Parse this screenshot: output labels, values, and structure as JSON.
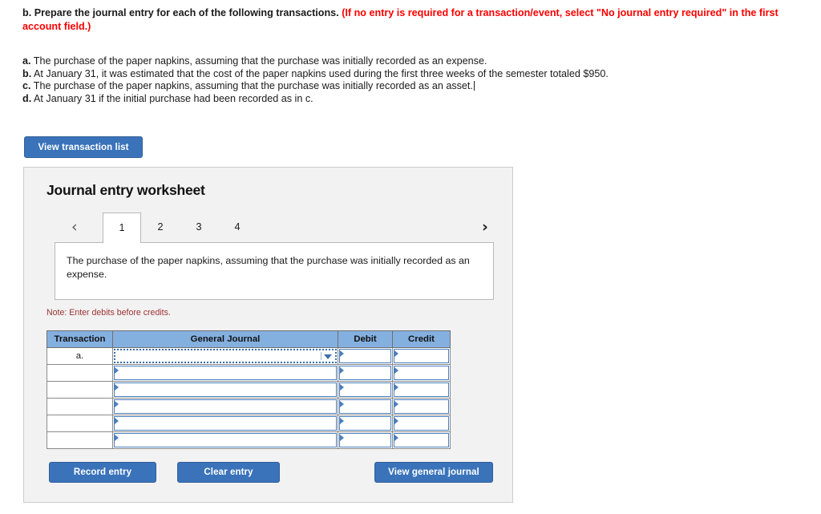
{
  "question": {
    "lead_label": "b.",
    "lead_text": " Prepare the journal entry for each of the following transactions. ",
    "red_note": "(If no entry is required for a transaction/event, select \"No journal entry required\" in the first account field.)",
    "items": [
      {
        "label": "a.",
        "text": " The purchase of the paper napkins, assuming that the purchase was initially recorded as an expense."
      },
      {
        "label": "b.",
        "text": " At January 31, it was estimated that the cost of the paper napkins used during the first three weeks of the semester totaled $950."
      },
      {
        "label": "c.",
        "text": " The purchase of the paper napkins, assuming that the purchase was initially recorded as an asset."
      },
      {
        "label": "d.",
        "text": " At January 31 if the initial purchase had been recorded as in c."
      }
    ]
  },
  "toolbar": {
    "view_transaction_list": "View transaction list"
  },
  "worksheet": {
    "title": "Journal entry worksheet",
    "prev_chevron": "‹",
    "next_chevron": "›",
    "tabs": [
      {
        "label": "1",
        "active": true
      },
      {
        "label": "2",
        "active": false
      },
      {
        "label": "3",
        "active": false
      },
      {
        "label": "4",
        "active": false
      }
    ],
    "prompt": "The purchase of the paper napkins, assuming that the purchase was initially recorded as an expense.",
    "note": "Note: Enter debits before credits."
  },
  "journal_table": {
    "headers": [
      "Transaction",
      "General Journal",
      "Debit",
      "Credit"
    ],
    "rows": [
      {
        "transaction": "a.",
        "general_journal": "",
        "debit": "",
        "credit": "",
        "combo": true
      },
      {
        "transaction": "",
        "general_journal": "",
        "debit": "",
        "credit": "",
        "combo": false
      },
      {
        "transaction": "",
        "general_journal": "",
        "debit": "",
        "credit": "",
        "combo": false
      },
      {
        "transaction": "",
        "general_journal": "",
        "debit": "",
        "credit": "",
        "combo": false
      },
      {
        "transaction": "",
        "general_journal": "",
        "debit": "",
        "credit": "",
        "combo": false
      },
      {
        "transaction": "",
        "general_journal": "",
        "debit": "",
        "credit": "",
        "combo": false
      }
    ]
  },
  "footer": {
    "record_entry": "Record entry",
    "clear_entry": "Clear entry",
    "view_general_journal": "View general journal"
  },
  "colors": {
    "button_blue": "#3a73ba",
    "table_header_blue": "#84b0e0",
    "panel_gray": "#f2f2f2",
    "red_instruction": "#ff0000",
    "note_red": "#9c3333",
    "input_border_blue": "#4a7fbc"
  }
}
